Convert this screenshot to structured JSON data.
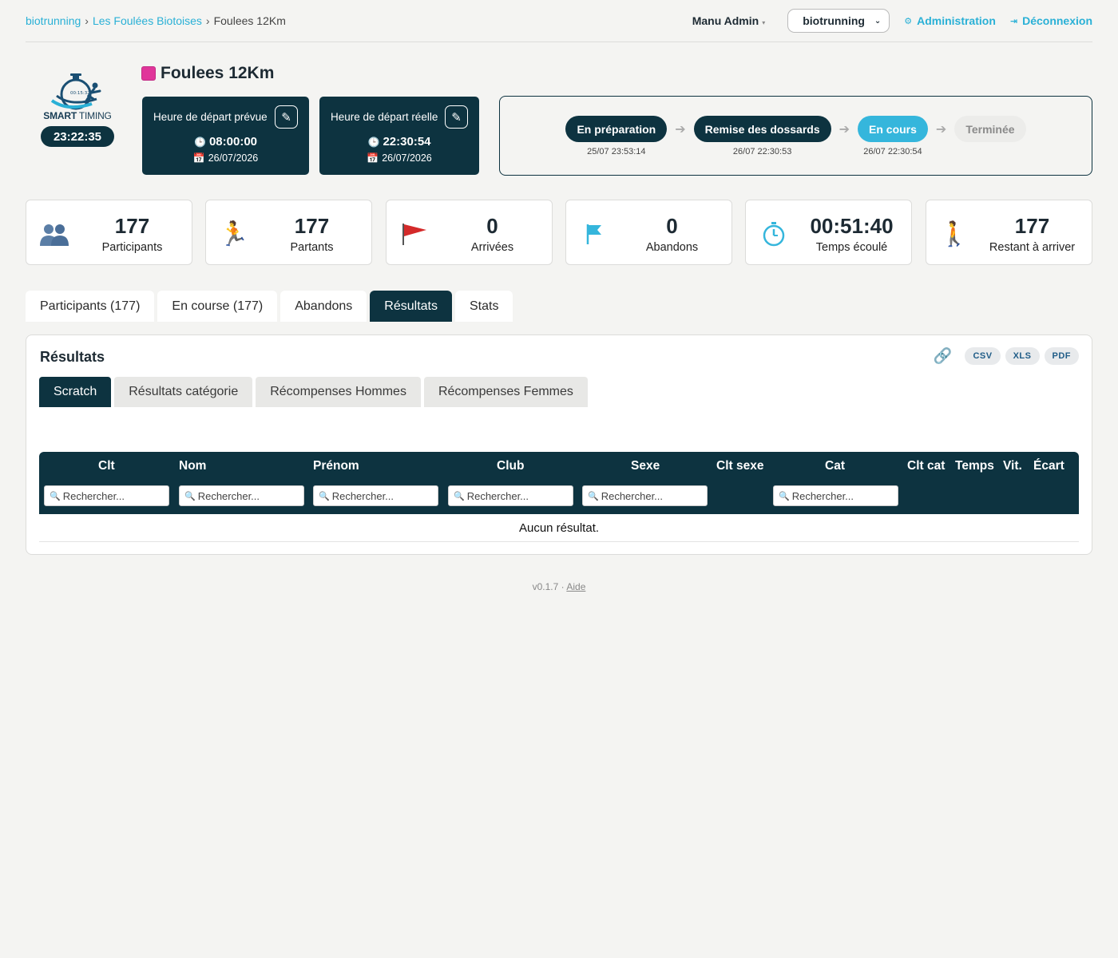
{
  "breadcrumb": {
    "items": [
      "biotrunning",
      "Les Foulées Biotoises",
      "Foulees 12Km"
    ],
    "separator": "›"
  },
  "header": {
    "user": "Manu Admin",
    "org_select": "biotrunning",
    "admin_link": "Administration",
    "logout_link": "Déconnexion"
  },
  "logo": {
    "brand_bold": "SMART",
    "brand_light": "TIMING",
    "clock": "23:22:35",
    "watch_face": "00:15:32"
  },
  "race": {
    "title": "Foulees 12Km",
    "color": "#e0359a"
  },
  "start_planned": {
    "label": "Heure de départ prévue",
    "time": "08:00:00",
    "date": "26/07/2026"
  },
  "start_actual": {
    "label": "Heure de départ réelle",
    "time": "22:30:54",
    "date": "26/07/2026"
  },
  "status_steps": [
    {
      "label": "En préparation",
      "timestamp": "25/07 23:53:14",
      "state": "done"
    },
    {
      "label": "Remise des dossards",
      "timestamp": "26/07 22:30:53",
      "state": "done"
    },
    {
      "label": "En cours",
      "timestamp": "26/07 22:30:54",
      "state": "active"
    },
    {
      "label": "Terminée",
      "timestamp": "",
      "state": "todo"
    }
  ],
  "stats": [
    {
      "icon": "group-icon",
      "value": "177",
      "label": "Participants"
    },
    {
      "icon": "runner-icon",
      "value": "177",
      "label": "Partants"
    },
    {
      "icon": "finish-flag-icon",
      "value": "0",
      "label": "Arrivées"
    },
    {
      "icon": "flag-icon",
      "value": "0",
      "label": "Abandons"
    },
    {
      "icon": "stopwatch-icon",
      "value": "00:51:40",
      "label": "Temps écoulé"
    },
    {
      "icon": "walker-icon",
      "value": "177",
      "label": "Restant à arriver"
    }
  ],
  "tabs": [
    "Participants (177)",
    "En course (177)",
    "Abandons",
    "Résultats",
    "Stats"
  ],
  "active_tab": "Résultats",
  "panel": {
    "title": "Résultats",
    "exports": [
      "CSV",
      "XLS",
      "PDF"
    ],
    "subtabs": [
      "Scratch",
      "Résultats catégorie",
      "Récompenses Hommes",
      "Récompenses Femmes"
    ],
    "active_subtab": "Scratch",
    "columns": [
      "Clt",
      "Nom",
      "Prénom",
      "Club",
      "Sexe",
      "Clt sexe",
      "Cat",
      "Clt cat",
      "Temps",
      "Vit.",
      "Écart"
    ],
    "filter_placeholder": "Rechercher...",
    "empty_message": "Aucun résultat."
  },
  "footer": {
    "version": "v0.1.7",
    "separator": "·",
    "help": "Aide"
  },
  "colors": {
    "primary": "#0d3340",
    "accent": "#35b6dc",
    "link": "#29b0d6"
  }
}
